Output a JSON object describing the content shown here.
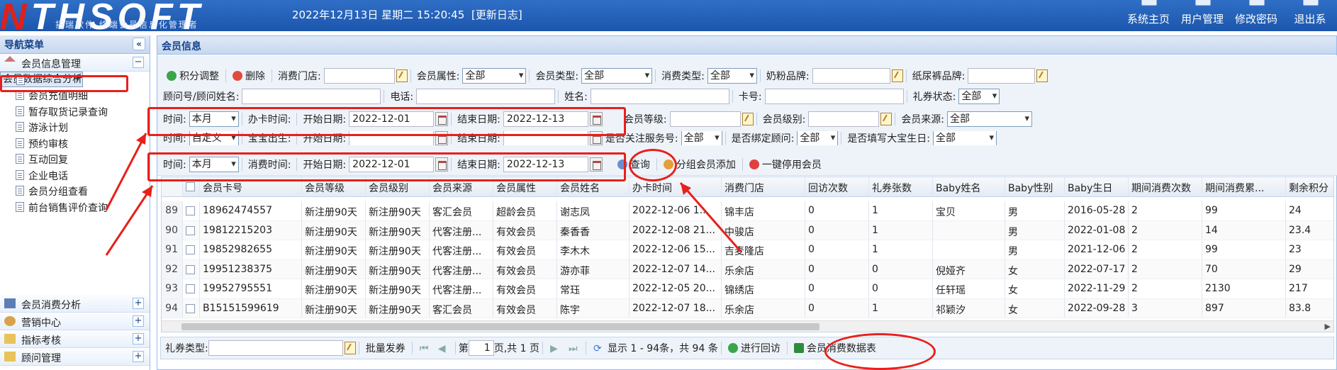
{
  "header": {
    "logo_text": "THSOFT",
    "logo_subtitle": "拓瑞软件 终端会员信息化管理者",
    "datetime": "2022年12月13日 星期二 15:20:45",
    "changelog": "[更新日志]",
    "nav": [
      {
        "label": "系统主页",
        "icon": "home-icon"
      },
      {
        "label": "用户管理",
        "icon": "user-icon"
      },
      {
        "label": "修改密码",
        "icon": "key-icon"
      },
      {
        "label": "退出系",
        "icon": "logout-icon"
      }
    ]
  },
  "sidebar": {
    "title": "导航菜单",
    "collapse": "«",
    "group1": {
      "label": "会员信息管理",
      "toggle": "−"
    },
    "items": [
      "会员数据综合分析",
      "会员充值明细",
      "暂存取货记录查询",
      "游泳计划",
      "预约审核",
      "互动回复",
      "企业电话",
      "会员分组查看",
      "前台销售评价查询"
    ],
    "groups": [
      {
        "label": "会员消费分析",
        "toggle": "+"
      },
      {
        "label": "营销中心",
        "toggle": "+"
      },
      {
        "label": "指标考核",
        "toggle": "+"
      },
      {
        "label": "顾问管理",
        "toggle": "+"
      }
    ]
  },
  "panel": {
    "title": "会员信息"
  },
  "row1": {
    "points_adjust": "积分调整",
    "delete": "删除",
    "store_label": "消费门店:",
    "store_value": "",
    "attr_label": "会员属性:",
    "attr_value": "全部",
    "type_label": "会员类型:",
    "type_value": "全部",
    "consume_type_label": "消费类型:",
    "consume_type_value": "全部",
    "milk_label": "奶粉品牌:",
    "milk_value": "",
    "diaper_label": "纸尿裤品牌:",
    "diaper_value": ""
  },
  "row2": {
    "advisor_label": "顾问号/顾问姓名:",
    "phone_label": "电话:",
    "name_label": "姓名:",
    "card_label": "卡号:",
    "coupon_status_label": "礼券状态:",
    "coupon_status_value": "全部"
  },
  "row3": {
    "time_label": "时间:",
    "time_value": "本月",
    "card_time_label": "办卡时间:",
    "start_label": "开始日期:",
    "start_value": "2022-12-01",
    "end_label": "结束日期:",
    "end_value": "2022-12-13",
    "level_label": "会员等级:",
    "rank_label": "会员级别:",
    "source_label": "会员来源:",
    "source_value": "全部"
  },
  "row4": {
    "time_label": "时间:",
    "time_value": "自定义",
    "baby_label": "宝宝出生:",
    "start_label": "开始日期:",
    "end_label": "结束日期:",
    "follow_label": "是否关注服务号:",
    "follow_value": "全部",
    "bind_label": "是否绑定顾问:",
    "bind_value": "全部",
    "fill_label": "是否填写大宝生日:",
    "fill_value": "全部"
  },
  "row5": {
    "time_label": "时间:",
    "time_value": "本月",
    "consume_time_label": "消费时间:",
    "start_label": "开始日期:",
    "start_value": "2022-12-01",
    "end_label": "结束日期:",
    "end_value": "2022-12-13",
    "query": "查询",
    "group_add": "分组会员添加",
    "disable": "一键停用会员"
  },
  "grid": {
    "headers": [
      "会员卡号",
      "会员等级",
      "会员级别",
      "会员来源",
      "会员属性",
      "会员姓名",
      "办卡时间",
      "消费门店",
      "回访次数",
      "礼券张数",
      "Baby姓名",
      "Baby性别",
      "Baby生日",
      "期间消费次数",
      "期间消费累...",
      "剩余积分"
    ],
    "rows": [
      [
        "89",
        "18962474557",
        "新注册90天",
        "新注册90天",
        "客汇会员",
        "超龄会员",
        "谢志凤",
        "2022-12-06 1...",
        "锦丰店",
        "0",
        "1",
        "宝贝",
        "男",
        "2016-05-28",
        "2",
        "99",
        "24"
      ],
      [
        "90",
        "19812215203",
        "新注册90天",
        "新注册90天",
        "代客注册...",
        "有效会员",
        "秦香香",
        "2022-12-08 21...",
        "中骏店",
        "0",
        "1",
        "",
        "男",
        "2022-01-08",
        "2",
        "14",
        "23.4"
      ],
      [
        "91",
        "19852982655",
        "新注册90天",
        "新注册90天",
        "代客注册...",
        "有效会员",
        "李木木",
        "2022-12-06 15...",
        "吉麦隆店",
        "0",
        "1",
        "",
        "男",
        "2021-12-06",
        "2",
        "99",
        "23"
      ],
      [
        "92",
        "19951238375",
        "新注册90天",
        "新注册90天",
        "代客注册...",
        "有效会员",
        "游亦菲",
        "2022-12-07 14...",
        "乐余店",
        "0",
        "0",
        "倪娅齐",
        "女",
        "2022-07-17",
        "2",
        "70",
        "29"
      ],
      [
        "93",
        "19952795551",
        "新注册90天",
        "新注册90天",
        "代客注册...",
        "有效会员",
        "常珏",
        "2022-12-05 20...",
        "锦绣店",
        "0",
        "0",
        "任轩瑶",
        "女",
        "2022-11-29",
        "2",
        "2130",
        "217"
      ],
      [
        "94",
        "B15151599619",
        "新注册90天",
        "新注册90天",
        "客汇会员",
        "有效会员",
        "陈宇",
        "2022-12-07 18...",
        "乐余店",
        "0",
        "1",
        "祁颖汐",
        "女",
        "2022-09-28",
        "3",
        "897",
        "83.8"
      ]
    ]
  },
  "bottom": {
    "coupon_type_label": "礼券类型:",
    "batch": "批量发券",
    "page_label": "第",
    "page_value": "1",
    "page_total": "页,共 1 页",
    "display": "显示 1 - 94条，共 94 条",
    "revisit": "进行回访",
    "export": "会员消费数据表"
  }
}
